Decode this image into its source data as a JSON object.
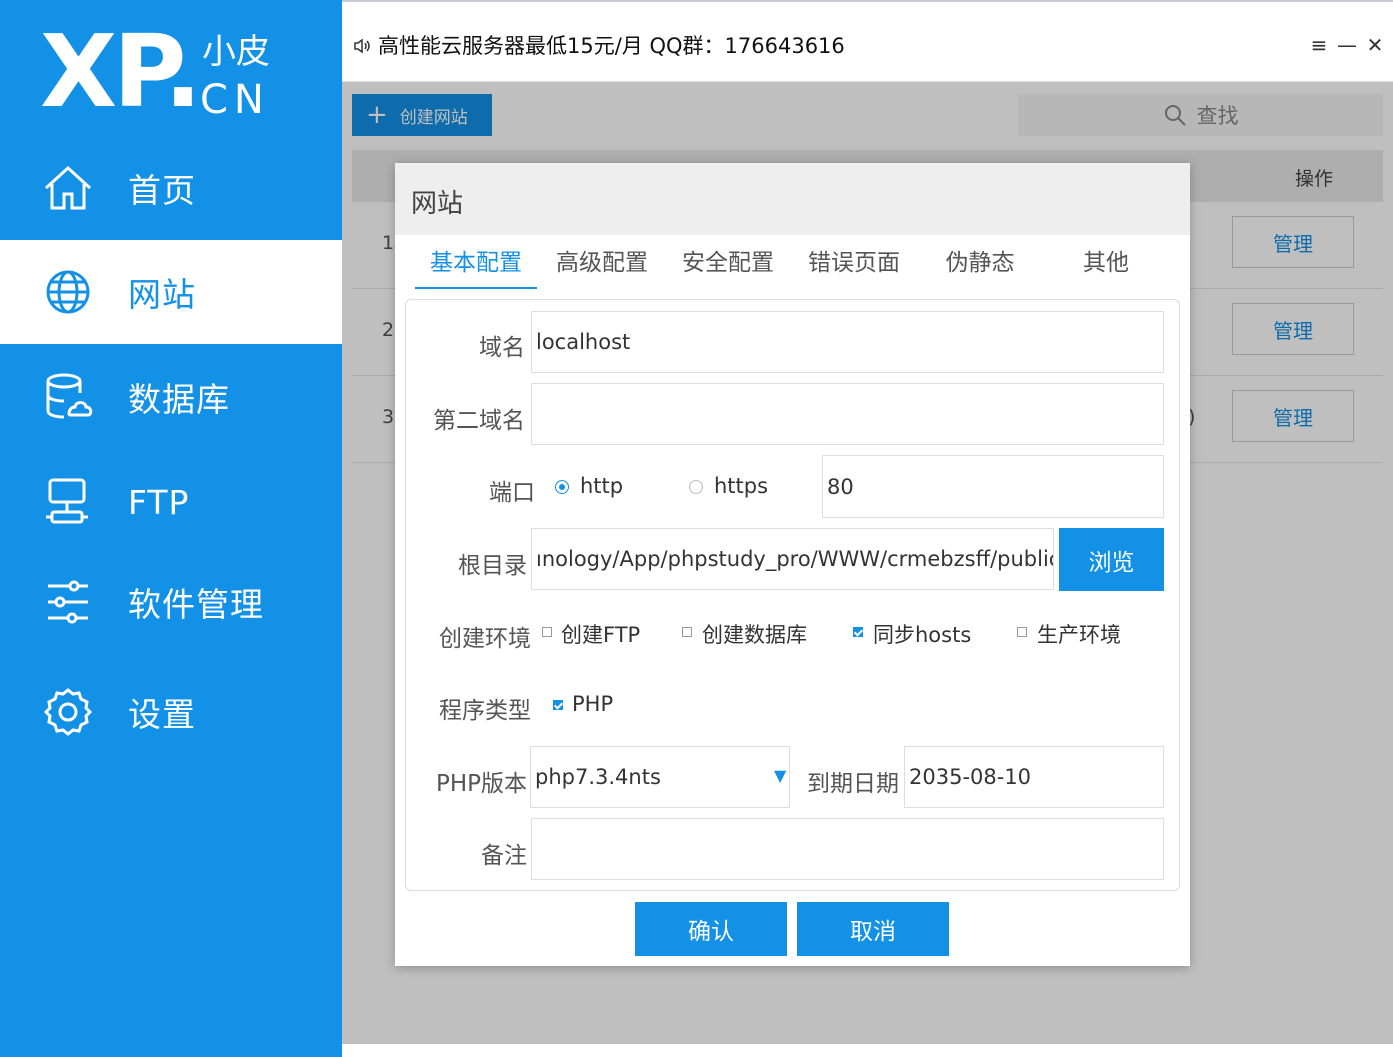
{
  "brand": {
    "logo_main": "XP.",
    "logo_small": "小皮",
    "logo_cn": "CN",
    "accent": "#1391e6"
  },
  "sidebar": {
    "items": [
      {
        "label": "首页",
        "icon": "home-icon",
        "active": false
      },
      {
        "label": "网站",
        "icon": "globe-icon",
        "active": true
      },
      {
        "label": "数据库",
        "icon": "database-icon",
        "active": false
      },
      {
        "label": "FTP",
        "icon": "server-icon",
        "active": false
      },
      {
        "label": "软件管理",
        "icon": "sliders-icon",
        "active": false
      },
      {
        "label": "设置",
        "icon": "gear-icon",
        "active": false
      }
    ]
  },
  "topbar": {
    "notice": "高性能云服务器最低15元/月  QQ群：176643616",
    "menu_glyph": "≡",
    "minimize_glyph": "—",
    "close_glyph": "✕"
  },
  "content": {
    "create_label": "创建网站",
    "search_label": "查找",
    "column_op": "操作",
    "rows": [
      {
        "index": "1",
        "manage": "管理",
        "tail": ""
      },
      {
        "index": "2",
        "manage": "管理",
        "tail": ""
      },
      {
        "index": "3",
        "manage": "管理",
        "tail": ")"
      }
    ]
  },
  "modal": {
    "title": "网站",
    "tabs": [
      "基本配置",
      "高级配置",
      "安全配置",
      "错误页面",
      "伪静态",
      "其他"
    ],
    "active_tab": 0,
    "fields": {
      "domain_label": "域名",
      "domain_value": "localhost",
      "second_domain_label": "第二域名",
      "second_domain_value": "",
      "port_label": "端口",
      "http_label": "http",
      "https_label": "https",
      "port_value": "80",
      "root_label": "根目录",
      "root_value": "ınology/App/phpstudy_pro/WWW/crmebzsff/public",
      "browse_label": "浏览",
      "env_label": "创建环境",
      "env_options": [
        {
          "label": "创建FTP",
          "checked": false
        },
        {
          "label": "创建数据库",
          "checked": false
        },
        {
          "label": "同步hosts",
          "checked": true
        },
        {
          "label": "生产环境",
          "checked": false
        }
      ],
      "program_label": "程序类型",
      "program_option": {
        "label": "PHP",
        "checked": true
      },
      "php_version_label": "PHP版本",
      "php_version_value": "php7.3.4nts",
      "expire_label": "到期日期",
      "expire_value": "2035-08-10",
      "note_label": "备注",
      "note_value": ""
    },
    "confirm_label": "确认",
    "cancel_label": "取消"
  }
}
